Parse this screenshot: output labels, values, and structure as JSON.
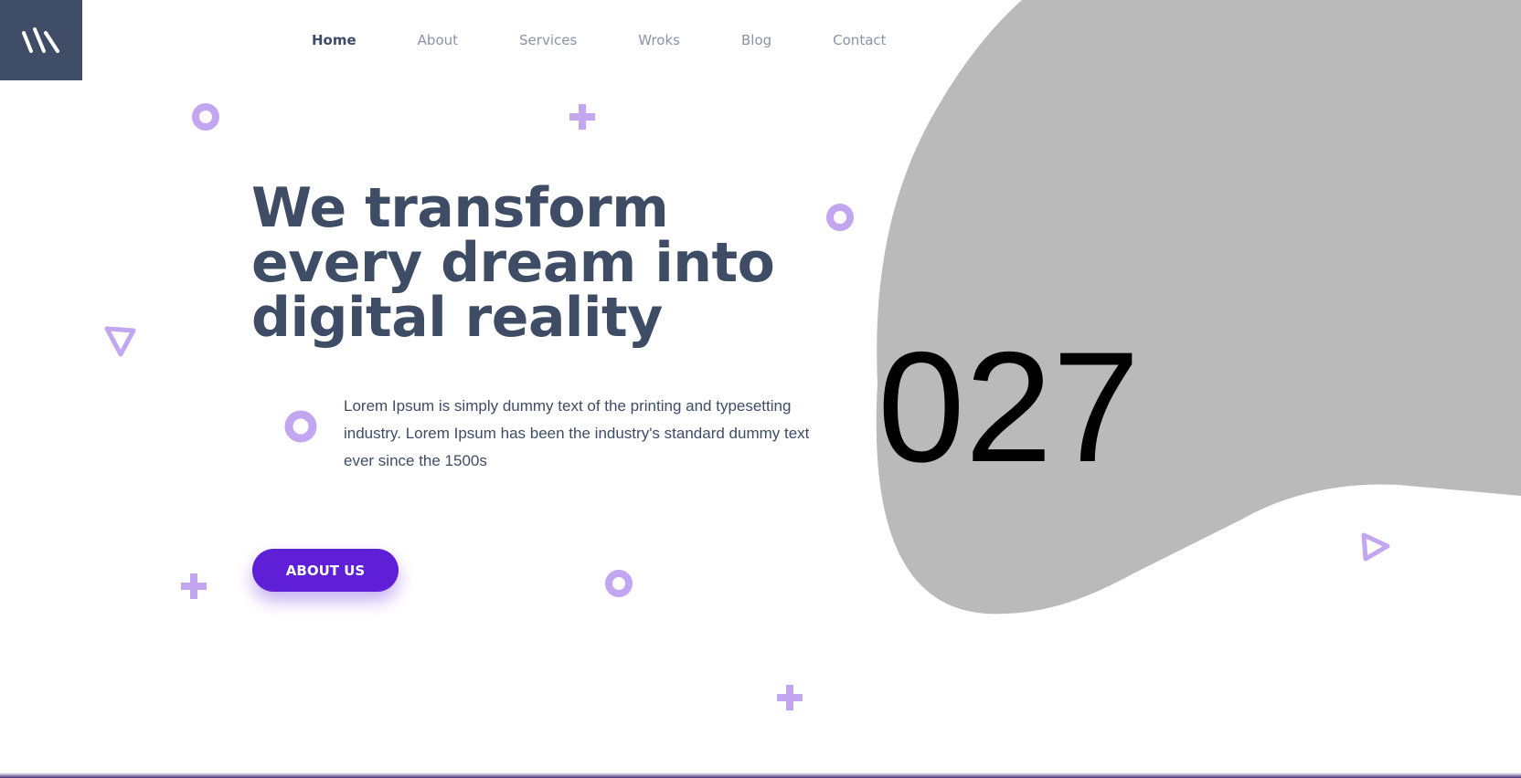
{
  "nav": {
    "items": [
      {
        "label": "Home",
        "active": true
      },
      {
        "label": "About",
        "active": false
      },
      {
        "label": "Services",
        "active": false
      },
      {
        "label": "Wroks",
        "active": false
      },
      {
        "label": "Blog",
        "active": false
      },
      {
        "label": "Contact",
        "active": false
      }
    ]
  },
  "hero": {
    "headline_lines": [
      "We transform",
      "every dream into",
      "digital reality"
    ],
    "description": "Lorem Ipsum is simply dummy text of the printing and typesetting industry. Lorem Ipsum has been the industry's standard dummy text ever since the 1500s",
    "button_label": "ABOUT US",
    "image_placeholder_text": "027"
  },
  "logo": {
    "icon": "three-slashes-logo-icon"
  },
  "decorations": {
    "icons": [
      "ring-icon",
      "plus-icon",
      "triangle-icon"
    ]
  },
  "colors": {
    "brand_dark": "#3e4c66",
    "accent_purple": "#5e1fd6",
    "decor_lavender": "#c3a6f0",
    "blob_gray": "#bababa",
    "nav_inactive": "#8a93a6"
  }
}
